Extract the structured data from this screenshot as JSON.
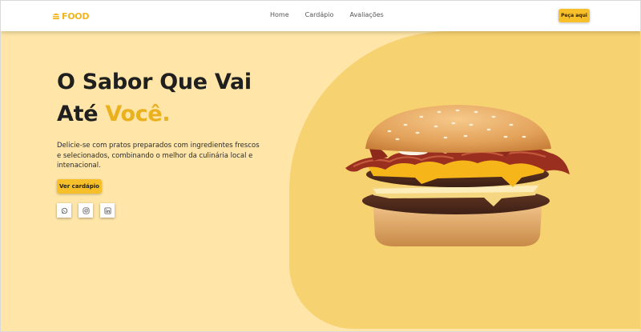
{
  "header": {
    "logo_text": "FOOD",
    "nav": [
      "Home",
      "Cardápio",
      "Avaliações"
    ],
    "order_button": "Peça aqui"
  },
  "hero": {
    "title_line1": "O Sabor Que Vai",
    "title_line2_prefix": "Até ",
    "title_highlight": "Você.",
    "description": "Delicie-se com pratos preparados com ingredientes frescos e selecionados, combinando o melhor da culinária local e intenacional.",
    "cta_button": "Ver cardápio",
    "socials": [
      "whatsapp-icon",
      "instagram-icon",
      "linkedin-icon"
    ]
  },
  "colors": {
    "accent": "#f7c02b",
    "highlight_text": "#eab01e",
    "background": "#ffe6a8",
    "blob": "#f7d271"
  }
}
